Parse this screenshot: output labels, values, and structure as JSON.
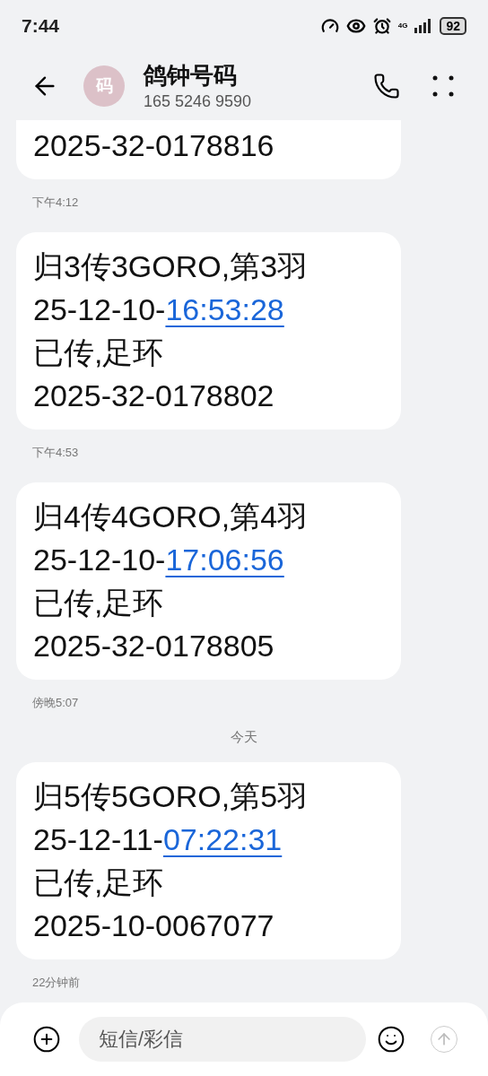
{
  "status_bar": {
    "time": "7:44",
    "network": "4G",
    "battery": "92"
  },
  "header": {
    "avatar": "码",
    "name": "鸽钟号码",
    "number": "165 5246 9590"
  },
  "conversation": [
    {
      "kind": "message",
      "cut_top": true,
      "lines": [
        {
          "text": "2025-32-0178816"
        }
      ]
    },
    {
      "kind": "time",
      "text": "下午4:12"
    },
    {
      "kind": "message",
      "cut_top": false,
      "lines": [
        {
          "text": "归3传3GORO,第3羽"
        },
        {
          "text": "25-12-10-",
          "link": "16:53:28"
        },
        {
          "text": "已传,足环"
        },
        {
          "text": "2025-32-0178802"
        }
      ]
    },
    {
      "kind": "time",
      "text": "下午4:53"
    },
    {
      "kind": "message",
      "cut_top": false,
      "lines": [
        {
          "text": "归4传4GORO,第4羽"
        },
        {
          "text": "25-12-10-",
          "link": "17:06:56"
        },
        {
          "text": "已传,足环"
        },
        {
          "text": "2025-32-0178805"
        }
      ]
    },
    {
      "kind": "time",
      "text": "傍晚5:07"
    },
    {
      "kind": "day",
      "text": "今天"
    },
    {
      "kind": "message",
      "cut_top": false,
      "lines": [
        {
          "text": "归5传5GORO,第5羽"
        },
        {
          "text": "25-12-11-",
          "link": "07:22:31"
        },
        {
          "text": "已传,足环"
        },
        {
          "text": "2025-10-0067077"
        }
      ]
    },
    {
      "kind": "time",
      "text": "22分钟前"
    }
  ],
  "composer": {
    "placeholder": "短信/彩信"
  }
}
